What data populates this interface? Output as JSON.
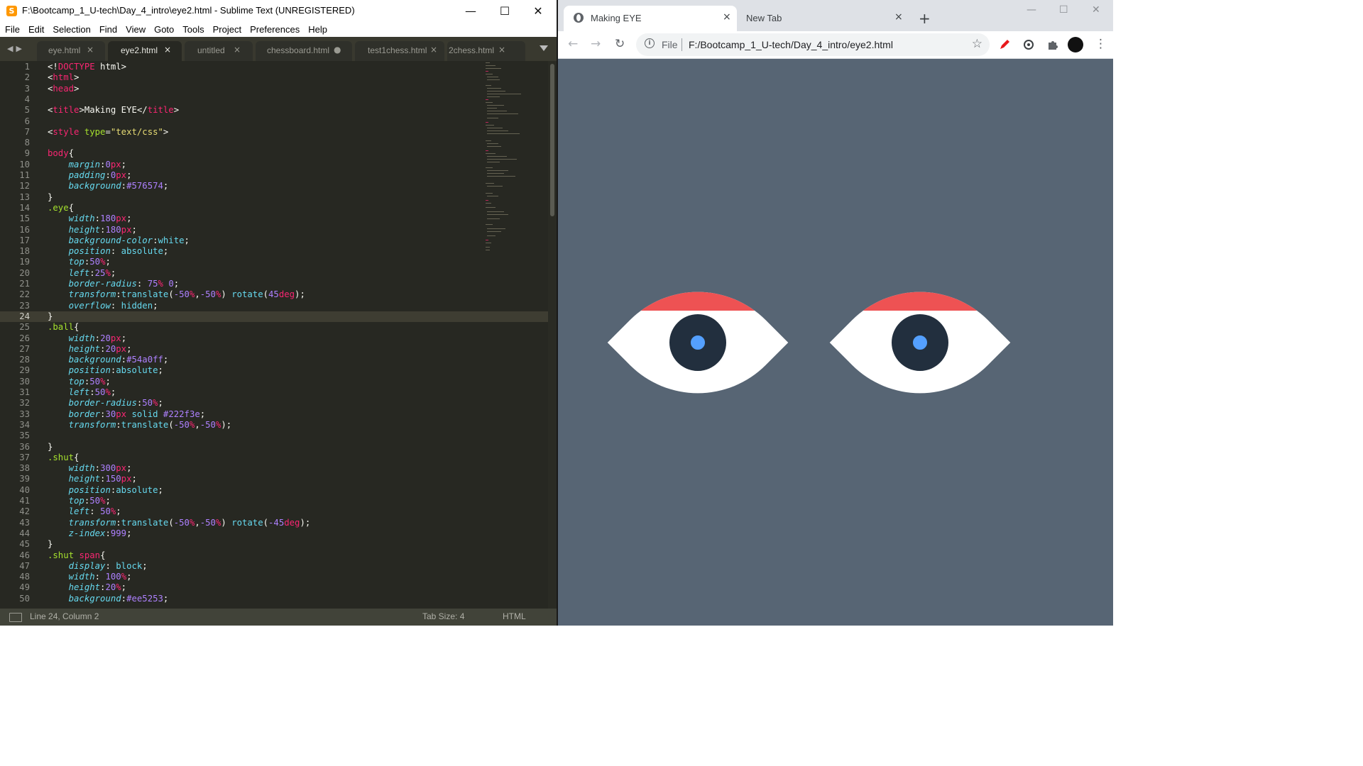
{
  "editor": {
    "title": "F:\\Bootcamp_1_U-tech\\Day_4_intro\\eye2.html - Sublime Text (UNREGISTERED)",
    "app_icon": "S",
    "menu": [
      "File",
      "Edit",
      "Selection",
      "Find",
      "View",
      "Goto",
      "Tools",
      "Project",
      "Preferences",
      "Help"
    ],
    "tabs": [
      {
        "label": "eye.html",
        "close": "×",
        "active": false
      },
      {
        "label": "eye2.html",
        "close": "×",
        "active": true
      },
      {
        "label": "untitled",
        "close": "×",
        "active": false
      },
      {
        "label": "chessboard.html",
        "close": "●",
        "active": false
      },
      {
        "label": "test1chess.html",
        "close": "×",
        "active": false
      },
      {
        "label": "2chess.html",
        "close": "×",
        "active": false
      }
    ],
    "cursor_line": 24,
    "code": [
      [
        [
          "t-plain",
          "<!"
        ],
        [
          "t-tag",
          "DOCTYPE"
        ],
        [
          "t-plain",
          " html>"
        ]
      ],
      [
        [
          "t-plain",
          "<"
        ],
        [
          "t-tag",
          "html"
        ],
        [
          "t-plain",
          ">"
        ]
      ],
      [
        [
          "t-plain",
          "<"
        ],
        [
          "t-tag",
          "head"
        ],
        [
          "t-plain",
          ">"
        ]
      ],
      [],
      [
        [
          "t-plain",
          "<"
        ],
        [
          "t-tag",
          "title"
        ],
        [
          "t-plain",
          ">Making EYE</"
        ],
        [
          "t-tag",
          "title"
        ],
        [
          "t-plain",
          ">"
        ]
      ],
      [],
      [
        [
          "t-plain",
          "<"
        ],
        [
          "t-tag",
          "style"
        ],
        [
          "t-plain",
          " "
        ],
        [
          "t-attr",
          "type"
        ],
        [
          "t-plain",
          "="
        ],
        [
          "t-str",
          "\"text/css\""
        ],
        [
          "t-plain",
          ">"
        ]
      ],
      [],
      [
        [
          "t-tag",
          "body"
        ],
        [
          "t-plain",
          "{"
        ]
      ],
      [
        [
          "t-plain",
          "    "
        ],
        [
          "t-prop",
          "margin"
        ],
        [
          "t-plain",
          ":"
        ],
        [
          "t-num",
          "0"
        ],
        [
          "t-unit",
          "px"
        ],
        [
          "t-plain",
          ";"
        ]
      ],
      [
        [
          "t-plain",
          "    "
        ],
        [
          "t-prop",
          "padding"
        ],
        [
          "t-plain",
          ":"
        ],
        [
          "t-num",
          "0"
        ],
        [
          "t-unit",
          "px"
        ],
        [
          "t-plain",
          ";"
        ]
      ],
      [
        [
          "t-plain",
          "    "
        ],
        [
          "t-prop",
          "background"
        ],
        [
          "t-plain",
          ":"
        ],
        [
          "t-num",
          "#576574"
        ],
        [
          "t-plain",
          ";"
        ]
      ],
      [
        [
          "t-plain",
          "}"
        ]
      ],
      [
        [
          "t-attr",
          ".eye"
        ],
        [
          "t-plain",
          "{"
        ]
      ],
      [
        [
          "t-plain",
          "    "
        ],
        [
          "t-prop",
          "width"
        ],
        [
          "t-plain",
          ":"
        ],
        [
          "t-num",
          "180"
        ],
        [
          "t-unit",
          "px"
        ],
        [
          "t-plain",
          ";"
        ]
      ],
      [
        [
          "t-plain",
          "    "
        ],
        [
          "t-prop",
          "height"
        ],
        [
          "t-plain",
          ":"
        ],
        [
          "t-num",
          "180"
        ],
        [
          "t-unit",
          "px"
        ],
        [
          "t-plain",
          ";"
        ]
      ],
      [
        [
          "t-plain",
          "    "
        ],
        [
          "t-prop",
          "background-color"
        ],
        [
          "t-plain",
          ":"
        ],
        [
          "t-val",
          "white"
        ],
        [
          "t-plain",
          ";"
        ]
      ],
      [
        [
          "t-plain",
          "    "
        ],
        [
          "t-prop",
          "position"
        ],
        [
          "t-plain",
          ": "
        ],
        [
          "t-val",
          "absolute"
        ],
        [
          "t-plain",
          ";"
        ]
      ],
      [
        [
          "t-plain",
          "    "
        ],
        [
          "t-prop",
          "top"
        ],
        [
          "t-plain",
          ":"
        ],
        [
          "t-num",
          "50"
        ],
        [
          "t-unit",
          "%"
        ],
        [
          "t-plain",
          ";"
        ]
      ],
      [
        [
          "t-plain",
          "    "
        ],
        [
          "t-prop",
          "left"
        ],
        [
          "t-plain",
          ":"
        ],
        [
          "t-num",
          "25"
        ],
        [
          "t-unit",
          "%"
        ],
        [
          "t-plain",
          ";"
        ]
      ],
      [
        [
          "t-plain",
          "    "
        ],
        [
          "t-prop",
          "border-radius"
        ],
        [
          "t-plain",
          ": "
        ],
        [
          "t-num",
          "75"
        ],
        [
          "t-unit",
          "%"
        ],
        [
          "t-plain",
          " "
        ],
        [
          "t-num",
          "0"
        ],
        [
          "t-plain",
          ";"
        ]
      ],
      [
        [
          "t-plain",
          "    "
        ],
        [
          "t-prop",
          "transform"
        ],
        [
          "t-plain",
          ":"
        ],
        [
          "t-val",
          "translate"
        ],
        [
          "t-plain",
          "("
        ],
        [
          "t-num",
          "-50"
        ],
        [
          "t-unit",
          "%"
        ],
        [
          "t-plain",
          ","
        ],
        [
          "t-num",
          "-50"
        ],
        [
          "t-unit",
          "%"
        ],
        [
          "t-plain",
          ") "
        ],
        [
          "t-val",
          "rotate"
        ],
        [
          "t-plain",
          "("
        ],
        [
          "t-num",
          "45"
        ],
        [
          "t-unit",
          "deg"
        ],
        [
          "t-plain",
          ");"
        ]
      ],
      [
        [
          "t-plain",
          "    "
        ],
        [
          "t-prop",
          "overflow"
        ],
        [
          "t-plain",
          ": "
        ],
        [
          "t-val",
          "hidden"
        ],
        [
          "t-plain",
          ";"
        ]
      ],
      [
        [
          "t-plain",
          "}"
        ]
      ],
      [
        [
          "t-attr",
          ".ball"
        ],
        [
          "t-plain",
          "{"
        ]
      ],
      [
        [
          "t-plain",
          "    "
        ],
        [
          "t-prop",
          "width"
        ],
        [
          "t-plain",
          ":"
        ],
        [
          "t-num",
          "20"
        ],
        [
          "t-unit",
          "px"
        ],
        [
          "t-plain",
          ";"
        ]
      ],
      [
        [
          "t-plain",
          "    "
        ],
        [
          "t-prop",
          "height"
        ],
        [
          "t-plain",
          ":"
        ],
        [
          "t-num",
          "20"
        ],
        [
          "t-unit",
          "px"
        ],
        [
          "t-plain",
          ";"
        ]
      ],
      [
        [
          "t-plain",
          "    "
        ],
        [
          "t-prop",
          "background"
        ],
        [
          "t-plain",
          ":"
        ],
        [
          "t-num",
          "#54a0ff"
        ],
        [
          "t-plain",
          ";"
        ]
      ],
      [
        [
          "t-plain",
          "    "
        ],
        [
          "t-prop",
          "position"
        ],
        [
          "t-plain",
          ":"
        ],
        [
          "t-val",
          "absolute"
        ],
        [
          "t-plain",
          ";"
        ]
      ],
      [
        [
          "t-plain",
          "    "
        ],
        [
          "t-prop",
          "top"
        ],
        [
          "t-plain",
          ":"
        ],
        [
          "t-num",
          "50"
        ],
        [
          "t-unit",
          "%"
        ],
        [
          "t-plain",
          ";"
        ]
      ],
      [
        [
          "t-plain",
          "    "
        ],
        [
          "t-prop",
          "left"
        ],
        [
          "t-plain",
          ":"
        ],
        [
          "t-num",
          "50"
        ],
        [
          "t-unit",
          "%"
        ],
        [
          "t-plain",
          ";"
        ]
      ],
      [
        [
          "t-plain",
          "    "
        ],
        [
          "t-prop",
          "border-radius"
        ],
        [
          "t-plain",
          ":"
        ],
        [
          "t-num",
          "50"
        ],
        [
          "t-unit",
          "%"
        ],
        [
          "t-plain",
          ";"
        ]
      ],
      [
        [
          "t-plain",
          "    "
        ],
        [
          "t-prop",
          "border"
        ],
        [
          "t-plain",
          ":"
        ],
        [
          "t-num",
          "30"
        ],
        [
          "t-unit",
          "px"
        ],
        [
          "t-plain",
          " "
        ],
        [
          "t-val",
          "solid"
        ],
        [
          "t-plain",
          " "
        ],
        [
          "t-num",
          "#222f3e"
        ],
        [
          "t-plain",
          ";"
        ]
      ],
      [
        [
          "t-plain",
          "    "
        ],
        [
          "t-prop",
          "transform"
        ],
        [
          "t-plain",
          ":"
        ],
        [
          "t-val",
          "translate"
        ],
        [
          "t-plain",
          "("
        ],
        [
          "t-num",
          "-50"
        ],
        [
          "t-unit",
          "%"
        ],
        [
          "t-plain",
          ","
        ],
        [
          "t-num",
          "-50"
        ],
        [
          "t-unit",
          "%"
        ],
        [
          "t-plain",
          ");"
        ]
      ],
      [],
      [
        [
          "t-plain",
          "}"
        ]
      ],
      [
        [
          "t-attr",
          ".shut"
        ],
        [
          "t-plain",
          "{"
        ]
      ],
      [
        [
          "t-plain",
          "    "
        ],
        [
          "t-prop",
          "width"
        ],
        [
          "t-plain",
          ":"
        ],
        [
          "t-num",
          "300"
        ],
        [
          "t-unit",
          "px"
        ],
        [
          "t-plain",
          ";"
        ]
      ],
      [
        [
          "t-plain",
          "    "
        ],
        [
          "t-prop",
          "height"
        ],
        [
          "t-plain",
          ":"
        ],
        [
          "t-num",
          "150"
        ],
        [
          "t-unit",
          "px"
        ],
        [
          "t-plain",
          ";"
        ]
      ],
      [
        [
          "t-plain",
          "    "
        ],
        [
          "t-prop",
          "position"
        ],
        [
          "t-plain",
          ":"
        ],
        [
          "t-val",
          "absolute"
        ],
        [
          "t-plain",
          ";"
        ]
      ],
      [
        [
          "t-plain",
          "    "
        ],
        [
          "t-prop",
          "top"
        ],
        [
          "t-plain",
          ":"
        ],
        [
          "t-num",
          "50"
        ],
        [
          "t-unit",
          "%"
        ],
        [
          "t-plain",
          ";"
        ]
      ],
      [
        [
          "t-plain",
          "    "
        ],
        [
          "t-prop",
          "left"
        ],
        [
          "t-plain",
          ": "
        ],
        [
          "t-num",
          "50"
        ],
        [
          "t-unit",
          "%"
        ],
        [
          "t-plain",
          ";"
        ]
      ],
      [
        [
          "t-plain",
          "    "
        ],
        [
          "t-prop",
          "transform"
        ],
        [
          "t-plain",
          ":"
        ],
        [
          "t-val",
          "translate"
        ],
        [
          "t-plain",
          "("
        ],
        [
          "t-num",
          "-50"
        ],
        [
          "t-unit",
          "%"
        ],
        [
          "t-plain",
          ","
        ],
        [
          "t-num",
          "-50"
        ],
        [
          "t-unit",
          "%"
        ],
        [
          "t-plain",
          ") "
        ],
        [
          "t-val",
          "rotate"
        ],
        [
          "t-plain",
          "("
        ],
        [
          "t-num",
          "-45"
        ],
        [
          "t-unit",
          "deg"
        ],
        [
          "t-plain",
          ");"
        ]
      ],
      [
        [
          "t-plain",
          "    "
        ],
        [
          "t-prop",
          "z-index"
        ],
        [
          "t-plain",
          ":"
        ],
        [
          "t-num",
          "999"
        ],
        [
          "t-plain",
          ";"
        ]
      ],
      [
        [
          "t-plain",
          "}"
        ]
      ],
      [
        [
          "t-attr",
          ".shut"
        ],
        [
          "t-plain",
          " "
        ],
        [
          "t-tag",
          "span"
        ],
        [
          "t-plain",
          "{"
        ]
      ],
      [
        [
          "t-plain",
          "    "
        ],
        [
          "t-prop",
          "display"
        ],
        [
          "t-plain",
          ": "
        ],
        [
          "t-val",
          "block"
        ],
        [
          "t-plain",
          ";"
        ]
      ],
      [
        [
          "t-plain",
          "    "
        ],
        [
          "t-prop",
          "width"
        ],
        [
          "t-plain",
          ": "
        ],
        [
          "t-num",
          "100"
        ],
        [
          "t-unit",
          "%"
        ],
        [
          "t-plain",
          ";"
        ]
      ],
      [
        [
          "t-plain",
          "    "
        ],
        [
          "t-prop",
          "height"
        ],
        [
          "t-plain",
          ":"
        ],
        [
          "t-num",
          "20"
        ],
        [
          "t-unit",
          "%"
        ],
        [
          "t-plain",
          ";"
        ]
      ],
      [
        [
          "t-plain",
          "    "
        ],
        [
          "t-prop",
          "background"
        ],
        [
          "t-plain",
          ":"
        ],
        [
          "t-num",
          "#ee5253"
        ],
        [
          "t-plain",
          ";"
        ]
      ]
    ],
    "status": {
      "position": "Line 24, Column 2",
      "tab_size": "Tab Size: 4",
      "syntax": "HTML"
    },
    "colors": {
      "background": "#272822",
      "tag": "#f92672",
      "attr": "#a6e22e",
      "string": "#e6db74",
      "property": "#66d9ef",
      "number": "#ae81ff"
    }
  },
  "browser": {
    "tabs": [
      {
        "label": "Making EYE",
        "close": "×",
        "active": true,
        "icon": "globe-icon"
      },
      {
        "label": "New Tab",
        "close": "×",
        "active": false
      }
    ],
    "new_tab": "+",
    "scheme_label": "File",
    "url": "F:/Bootcamp_1_U-tech/Day_4_intro/eye2.html",
    "page_background": "#576574",
    "eye_colors": {
      "sclera": "#ffffff",
      "iris": "#222f3e",
      "pupil": "#54a0ff",
      "lid": "#ee5253"
    },
    "eyes": 2
  }
}
